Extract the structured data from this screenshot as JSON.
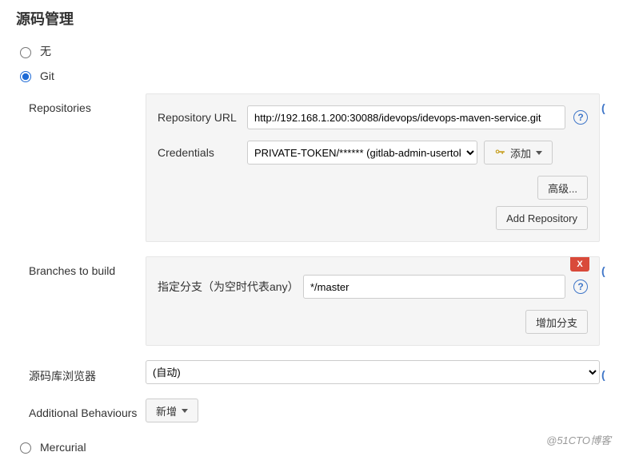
{
  "section_title": "源码管理",
  "scm_options": {
    "none": {
      "label": "无",
      "checked": false
    },
    "git": {
      "label": "Git",
      "checked": true
    },
    "mercurial": {
      "label": "Mercurial",
      "checked": false
    }
  },
  "repos": {
    "label": "Repositories",
    "url_label": "Repository URL",
    "url_value": "http://192.168.1.200:30088/idevops/idevops-maven-service.git",
    "cred_label": "Credentials",
    "cred_value": "PRIVATE-TOKEN/****** (gitlab-admin-usertoken)",
    "add_cred_label": "添加",
    "advanced_label": "高级...",
    "add_repo_label": "Add Repository",
    "help_text": "?"
  },
  "branches": {
    "label": "Branches to build",
    "spec_label": "指定分支（为空时代表any）",
    "spec_value": "*/master",
    "delete_label": "X",
    "add_branch_label": "增加分支",
    "help_text": "?"
  },
  "browser": {
    "label": "源码库浏览器",
    "value": "(自动)"
  },
  "behaviours": {
    "label": "Additional Behaviours",
    "add_label": "新增"
  },
  "watermark": "@51CTO博客"
}
